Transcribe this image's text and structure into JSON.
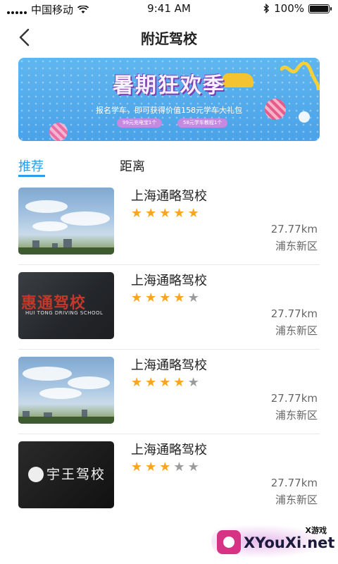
{
  "status_bar": {
    "carrier": "中国移动",
    "time": "9:41 AM",
    "battery": "100%"
  },
  "header": {
    "title": "附近驾校"
  },
  "banner": {
    "title": "暑期狂欢季",
    "subtitle": "报名学车，即可获得价值158元学车大礼包",
    "pill_left": "99元充电宝1个",
    "pill_right": "58元学车教程1个"
  },
  "tabs": [
    {
      "label": "推荐",
      "active": true
    },
    {
      "label": "距离",
      "active": false
    }
  ],
  "schools": [
    {
      "name": "上海通略驾校",
      "rating": 5,
      "distance": "27.77km",
      "area": "浦东新区",
      "image": "sky-photo"
    },
    {
      "name": "上海通略驾校",
      "rating": 4,
      "distance": "27.77km",
      "area": "浦东新区",
      "image": "huitong-logo",
      "image_text": "惠通驾校",
      "image_subtext": "HUI TONG DRIVING SCHOOL"
    },
    {
      "name": "上海通略驾校",
      "rating": 4,
      "distance": "27.77km",
      "area": "浦东新区",
      "image": "sky-photo"
    },
    {
      "name": "上海通略驾校",
      "rating": 3,
      "distance": "27.77km",
      "area": "浦东新区",
      "image": "yuwang-logo",
      "image_text": "宇王驾校"
    }
  ],
  "watermark": {
    "small": "X游戏",
    "text": "XYouXi.net"
  },
  "colors": {
    "accent": "#2a9ee8",
    "star_on": "#f5a623",
    "star_off": "#9b9b9b"
  }
}
